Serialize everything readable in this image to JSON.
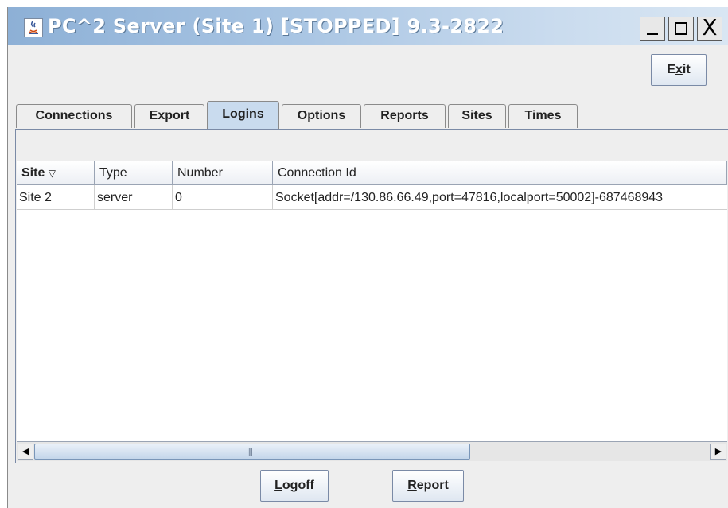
{
  "window": {
    "title": "PC^2 Server (Site 1) [STOPPED] 9.3-2822",
    "minimize_glyph": "_",
    "close_glyph": "X"
  },
  "toolbar": {
    "exit_label": "Exit"
  },
  "tabs": [
    {
      "label": "Connections",
      "selected": false
    },
    {
      "label": "Export",
      "selected": false
    },
    {
      "label": "Logins",
      "selected": true
    },
    {
      "label": "Options",
      "selected": false
    },
    {
      "label": "Reports",
      "selected": false
    },
    {
      "label": "Sites",
      "selected": false
    },
    {
      "label": "Times",
      "selected": false
    }
  ],
  "table": {
    "columns": [
      "Site",
      "Type",
      "Number",
      "Connection Id"
    ],
    "sort_indicator": "▽",
    "rows": [
      [
        "Site 2",
        "server",
        "0",
        "Socket[addr=/130.86.66.49,port=47816,localport=50002]-687468943"
      ]
    ]
  },
  "scrollbar": {
    "left_arrow": "◀",
    "right_arrow": "▶",
    "grip": "|||"
  },
  "buttons": {
    "logoff_label": "Logoff",
    "report_label": "Report"
  },
  "colors": {
    "titlebar": "#a9c5e3",
    "active_tab": "#c9dbee",
    "background": "#eeeeee"
  }
}
